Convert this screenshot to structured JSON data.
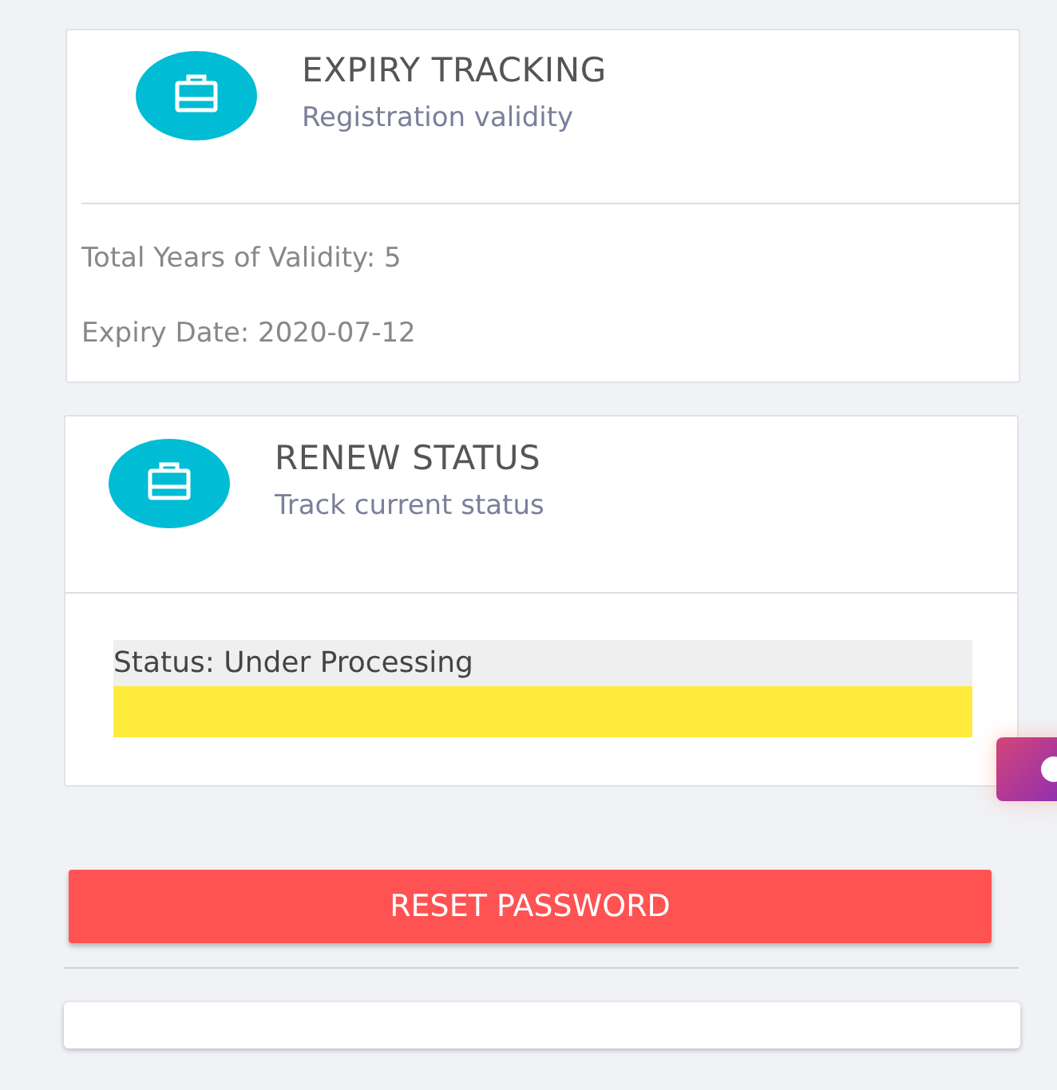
{
  "cards": [
    {
      "title": "EXPIRY TRACKING",
      "subtitle": "Registration validity",
      "lines": [
        "Total Years of Validity: 5",
        "Expiry Date: 2020-07-12"
      ]
    },
    {
      "title": "RENEW STATUS",
      "subtitle": "Track current status",
      "status": {
        "label": "Status: Under Processing",
        "color": "#ffeb3b",
        "level": 1
      }
    }
  ],
  "button": "RESET PASSWORD"
}
